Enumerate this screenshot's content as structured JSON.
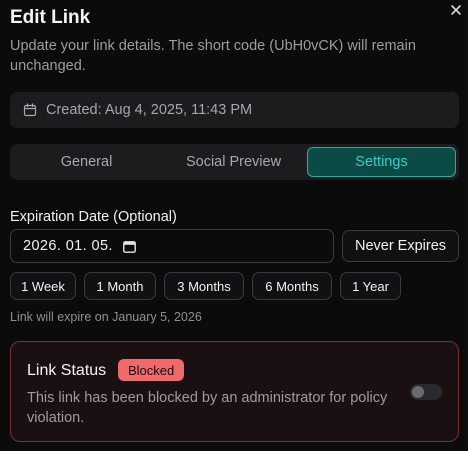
{
  "dialog": {
    "title": "Edit Link",
    "description": "Update your link details. The short code (UbH0vCK) will remain unchanged."
  },
  "created": {
    "text": "Created: Aug 4, 2025, 11:43 PM"
  },
  "tabs": [
    {
      "label": "General",
      "active": false
    },
    {
      "label": "Social Preview",
      "active": false
    },
    {
      "label": "Settings",
      "active": true
    }
  ],
  "expiration": {
    "label": "Expiration Date (Optional)",
    "value": "2026. 01. 05.",
    "never_expires_label": "Never Expires",
    "presets": [
      "1 Week",
      "1 Month",
      "3 Months",
      "6 Months",
      "1 Year"
    ],
    "hint": "Link will expire on January 5, 2026"
  },
  "link_status": {
    "title": "Link Status",
    "badge": "Blocked",
    "description": "This link has been blocked by an administrator for policy violation.",
    "enabled": false
  },
  "colors": {
    "accent": "#2fd1c4",
    "danger": "#f06a6c",
    "background": "#0b0b0c"
  }
}
